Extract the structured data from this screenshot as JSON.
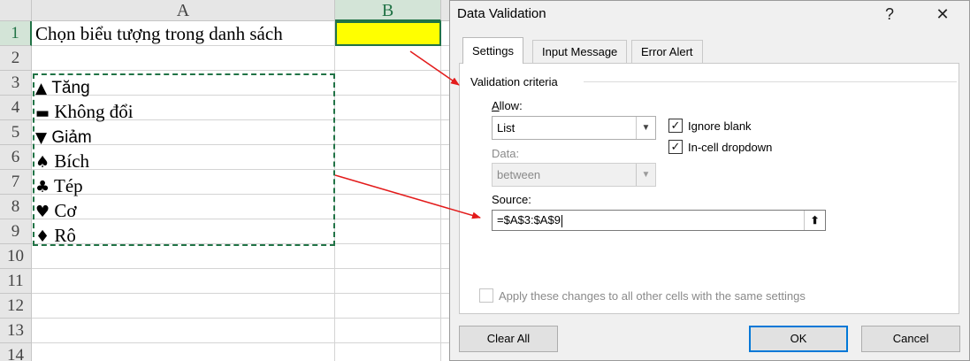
{
  "sheet": {
    "columns": [
      "A",
      "B"
    ],
    "rows": [
      "1",
      "2",
      "3",
      "4",
      "5",
      "6",
      "7",
      "8",
      "9",
      "10",
      "11",
      "12",
      "13",
      "14"
    ],
    "a1": "Chọn biểu tượng trong danh sách",
    "list": [
      {
        "symbol": "▲",
        "text": "Tăng"
      },
      {
        "symbol": "▬",
        "text": "Không đổi"
      },
      {
        "symbol": "▼",
        "text": "Giảm"
      },
      {
        "symbol": "♠",
        "text": "Bích"
      },
      {
        "symbol": "♣",
        "text": "Tép"
      },
      {
        "symbol": "♥",
        "text": "Cơ"
      },
      {
        "symbol": "♦",
        "text": "Rô"
      }
    ],
    "b1_fill": "#ffff00",
    "selection_color": "#217346"
  },
  "dialog": {
    "title": "Data Validation",
    "help": "?",
    "close": "✕",
    "tabs": [
      {
        "label": "Settings",
        "active": true
      },
      {
        "label": "Input Message",
        "active": false
      },
      {
        "label": "Error Alert",
        "active": false
      }
    ],
    "group_title": "Validation criteria",
    "allow_label": "Allow:",
    "allow_value": "List",
    "data_label": "Data:",
    "data_value": "between",
    "ignore_blank": {
      "label": "Ignore blank",
      "checked": true
    },
    "in_cell_dropdown": {
      "label": "In-cell dropdown",
      "checked": true
    },
    "source_label": "Source:",
    "source_value": "=$A$3:$A$9",
    "apply_all": {
      "label": "Apply these changes to all other cells with the same settings",
      "checked": false,
      "enabled": false
    },
    "buttons": {
      "clear_all": "Clear All",
      "ok": "OK",
      "cancel": "Cancel"
    }
  },
  "icons": {
    "combo_arrow": "chevron-down-icon",
    "check": "check-icon",
    "collapse": "collapse-dialog-icon",
    "annotation_arrow": "red-arrow-icon"
  },
  "colors": {
    "accent": "#0078d7",
    "arrow": "#e31b1b"
  }
}
